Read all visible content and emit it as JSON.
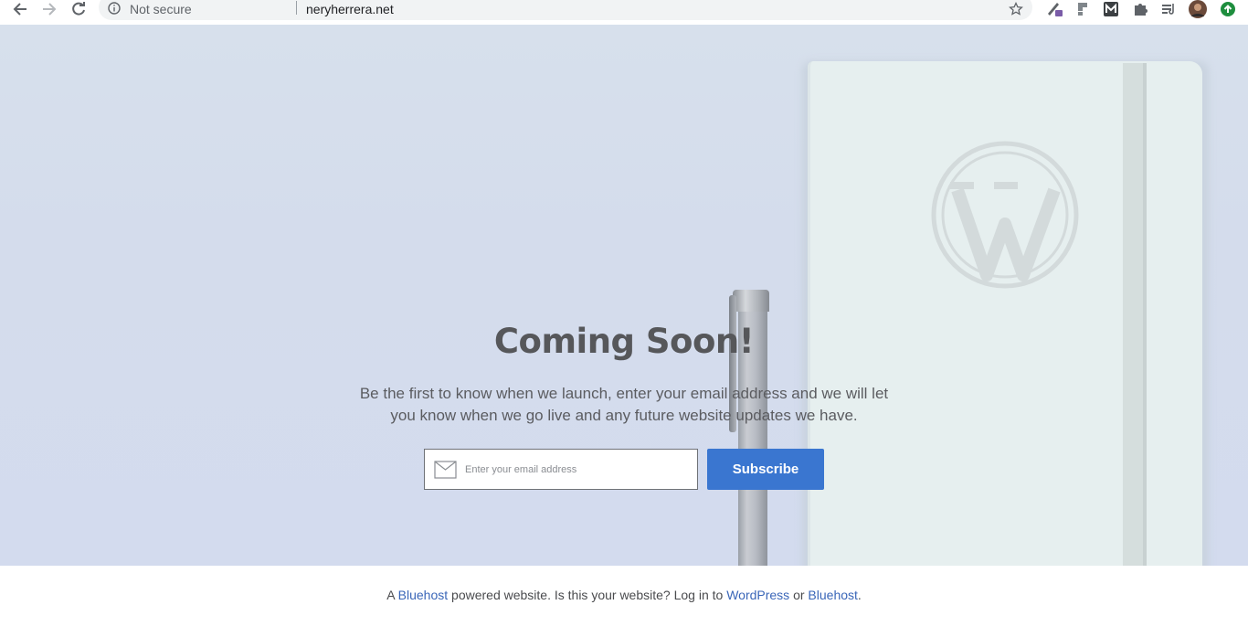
{
  "browser": {
    "security_label": "Not secure",
    "url": "neryherrera.net",
    "icons": [
      "back-icon",
      "forward-icon",
      "reload-icon",
      "info-icon",
      "star-icon",
      "pen-extension-icon",
      "extension-icon",
      "m-extension-icon",
      "puzzle-icon",
      "media-queue-icon",
      "profile-avatar",
      "update-icon"
    ]
  },
  "hero": {
    "headline": "Coming Soon!",
    "description": "Be the first to know when we launch, enter your email address and we will let you know when we go live and any future website updates we have.",
    "email_placeholder": "Enter your email address",
    "subscribe_label": "Subscribe"
  },
  "footer": {
    "part1": "A ",
    "link_bluehost_1": "Bluehost",
    "part2": " powered website. Is this your website? Log in to ",
    "link_wordpress": "WordPress",
    "part3": " or ",
    "link_bluehost_2": "Bluehost",
    "part4": "."
  },
  "colors": {
    "accent": "#3a76d0",
    "link": "#3a66b8",
    "hero_bg": "#d6dfec"
  }
}
